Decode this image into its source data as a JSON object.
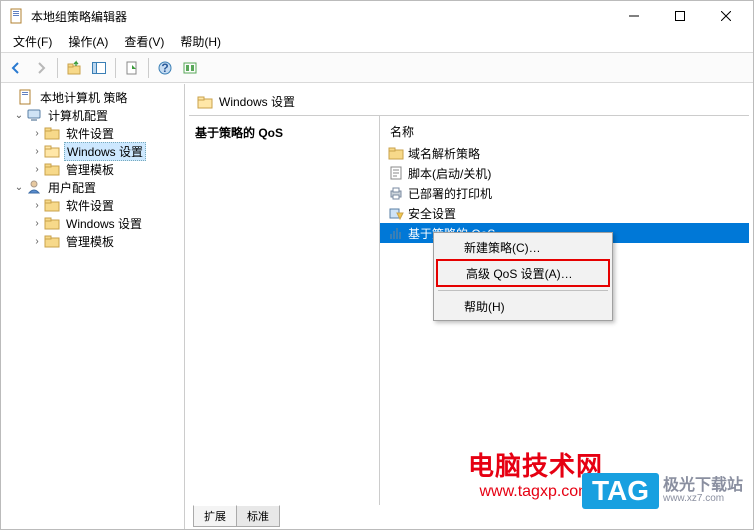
{
  "window": {
    "title": "本地组策略编辑器"
  },
  "menu": {
    "file": "文件(F)",
    "action": "操作(A)",
    "view": "查看(V)",
    "help": "帮助(H)"
  },
  "tree": {
    "root": "本地计算机 策略",
    "computer_config": "计算机配置",
    "cc_software": "软件设置",
    "cc_windows": "Windows 设置",
    "cc_templates": "管理模板",
    "user_config": "用户配置",
    "uc_software": "软件设置",
    "uc_windows": "Windows 设置",
    "uc_templates": "管理模板"
  },
  "detail": {
    "header": "Windows 设置",
    "panel_title": "基于策略的 QoS",
    "column_name": "名称",
    "items": {
      "dns": "域名解析策略",
      "scripts": "脚本(启动/关机)",
      "printers": "已部署的打印机",
      "security": "安全设置",
      "qos": "基于策略的 QoS"
    },
    "tabs": {
      "extended": "扩展",
      "standard": "标准"
    }
  },
  "context_menu": {
    "new_policy": "新建策略(C)…",
    "advanced": "高级 QoS 设置(A)…",
    "help": "帮助(H)"
  },
  "watermarks": {
    "site1_line1": "电脑技术网",
    "site1_line2": "www.tagxp.com",
    "site2_badge": "TAG",
    "site2_a": "极光下载站",
    "site2_b": "www.xz7.com"
  }
}
